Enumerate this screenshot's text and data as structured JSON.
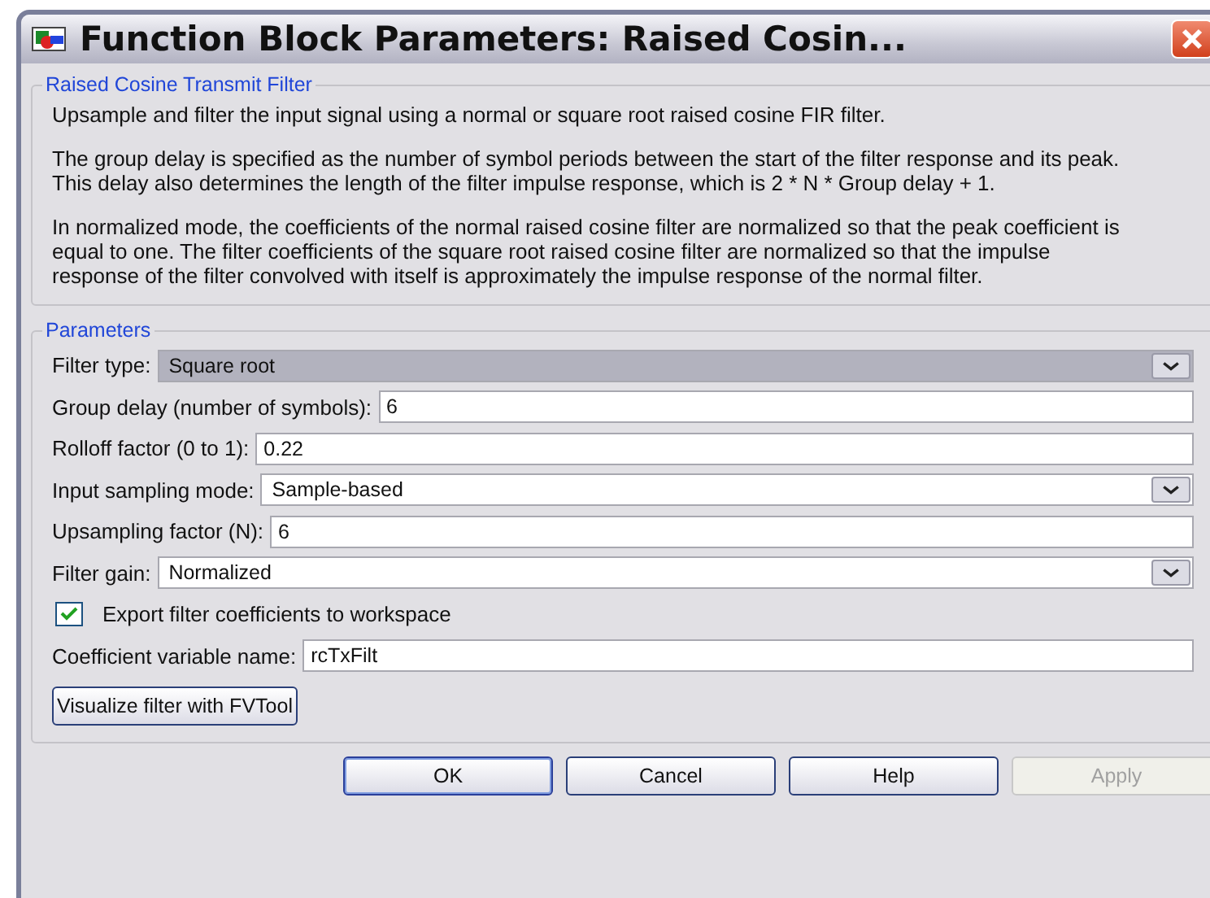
{
  "window": {
    "title": "Function Block Parameters: Raised Cosin..."
  },
  "description": {
    "title": "Raised Cosine Transmit Filter",
    "paragraphs": [
      "Upsample and filter the input signal using a normal or square root raised cosine FIR filter.",
      "The group delay is specified as the number of symbol periods between the start of the filter response and its peak. This delay also determines the length of the filter impulse response, which is 2 * N * Group delay + 1.",
      "In normalized mode, the coefficients of the normal raised cosine filter are normalized so that the peak coefficient is equal to one. The filter coefficients of the square root raised cosine filter are normalized so that the impulse response of the filter convolved with itself is approximately the impulse response of the normal filter."
    ]
  },
  "parameters": {
    "title": "Parameters",
    "fields": [
      {
        "kind": "dropdown",
        "label": "Filter type:",
        "value": "Square root",
        "focused": true
      },
      {
        "kind": "text",
        "label": "Group delay (number of symbols):",
        "value": "6",
        "focused": false
      },
      {
        "kind": "text",
        "label": "Rolloff factor (0 to 1):",
        "value": "0.22",
        "focused": false
      },
      {
        "kind": "dropdown",
        "label": "Input sampling mode:",
        "value": "Sample-based",
        "focused": false
      },
      {
        "kind": "text",
        "label": "Upsampling factor (N):",
        "value": "6",
        "focused": false
      },
      {
        "kind": "dropdown",
        "label": "Filter gain:",
        "value": "Normalized",
        "focused": false
      },
      {
        "kind": "checkbox",
        "label": "Export filter coefficients to workspace",
        "checked": true
      },
      {
        "kind": "text",
        "label": "Coefficient variable name:",
        "value": "rcTxFilt",
        "focused": false
      },
      {
        "kind": "button",
        "label": "Visualize filter with FVTool"
      }
    ]
  },
  "buttons": [
    {
      "label": "OK",
      "disabled": false,
      "default": true
    },
    {
      "label": "Cancel",
      "disabled": false,
      "default": false
    },
    {
      "label": "Help",
      "disabled": false,
      "default": false
    },
    {
      "label": "Apply",
      "disabled": true,
      "default": false
    }
  ]
}
